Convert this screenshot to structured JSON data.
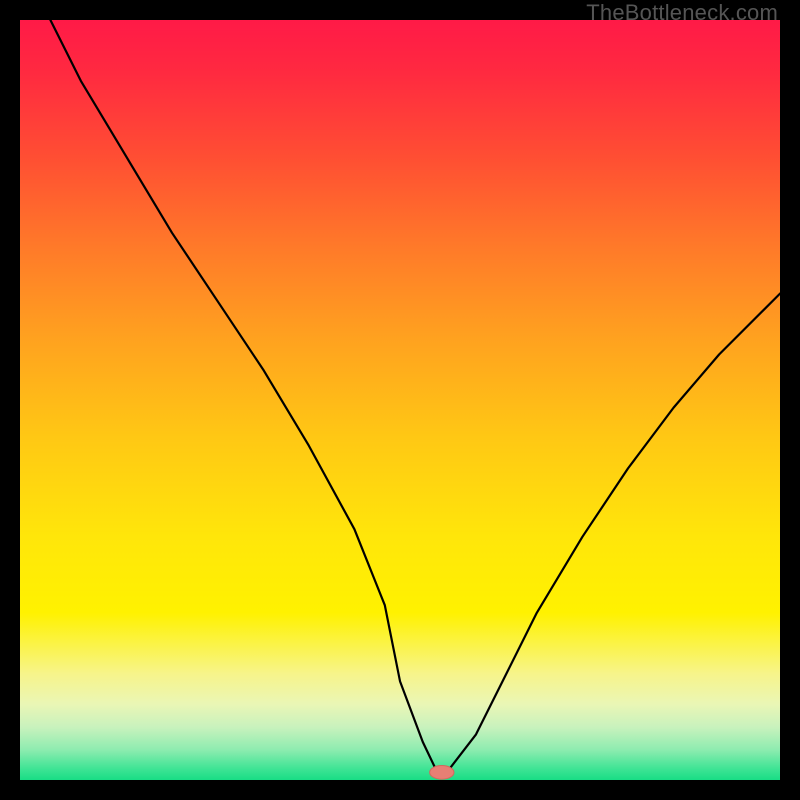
{
  "watermark": "TheBottleneck.com",
  "chart_data": {
    "type": "line",
    "title": "",
    "xlabel": "",
    "ylabel": "",
    "xlim": [
      0,
      100
    ],
    "ylim": [
      0,
      100
    ],
    "background_gradient_stops": [
      {
        "offset": 0.0,
        "color": "#ff1a47"
      },
      {
        "offset": 0.07,
        "color": "#ff2a40"
      },
      {
        "offset": 0.18,
        "color": "#ff4e33"
      },
      {
        "offset": 0.3,
        "color": "#ff7a29"
      },
      {
        "offset": 0.42,
        "color": "#ffa21f"
      },
      {
        "offset": 0.55,
        "color": "#ffc814"
      },
      {
        "offset": 0.68,
        "color": "#ffe60a"
      },
      {
        "offset": 0.78,
        "color": "#fff200"
      },
      {
        "offset": 0.86,
        "color": "#f7f48a"
      },
      {
        "offset": 0.9,
        "color": "#eaf6b5"
      },
      {
        "offset": 0.93,
        "color": "#c9f2bd"
      },
      {
        "offset": 0.96,
        "color": "#8eecb0"
      },
      {
        "offset": 0.985,
        "color": "#3fe495"
      },
      {
        "offset": 1.0,
        "color": "#18dd85"
      }
    ],
    "series": [
      {
        "name": "bottleneck-curve",
        "color": "#000000",
        "width": 2.2,
        "x": [
          4,
          8,
          14,
          20,
          26,
          32,
          38,
          44,
          48,
          50,
          53,
          55,
          56,
          60,
          64,
          68,
          74,
          80,
          86,
          92,
          98,
          100
        ],
        "y": [
          100,
          92,
          82,
          72,
          63,
          54,
          44,
          33,
          23,
          13,
          5,
          0.8,
          0.8,
          6,
          14,
          22,
          32,
          41,
          49,
          56,
          62,
          64
        ]
      }
    ],
    "marker": {
      "name": "min-point",
      "x": 55.5,
      "y": 1.0,
      "rx": 1.6,
      "ry": 0.9,
      "fill": "#e77f74",
      "stroke": "#d3685d"
    }
  }
}
